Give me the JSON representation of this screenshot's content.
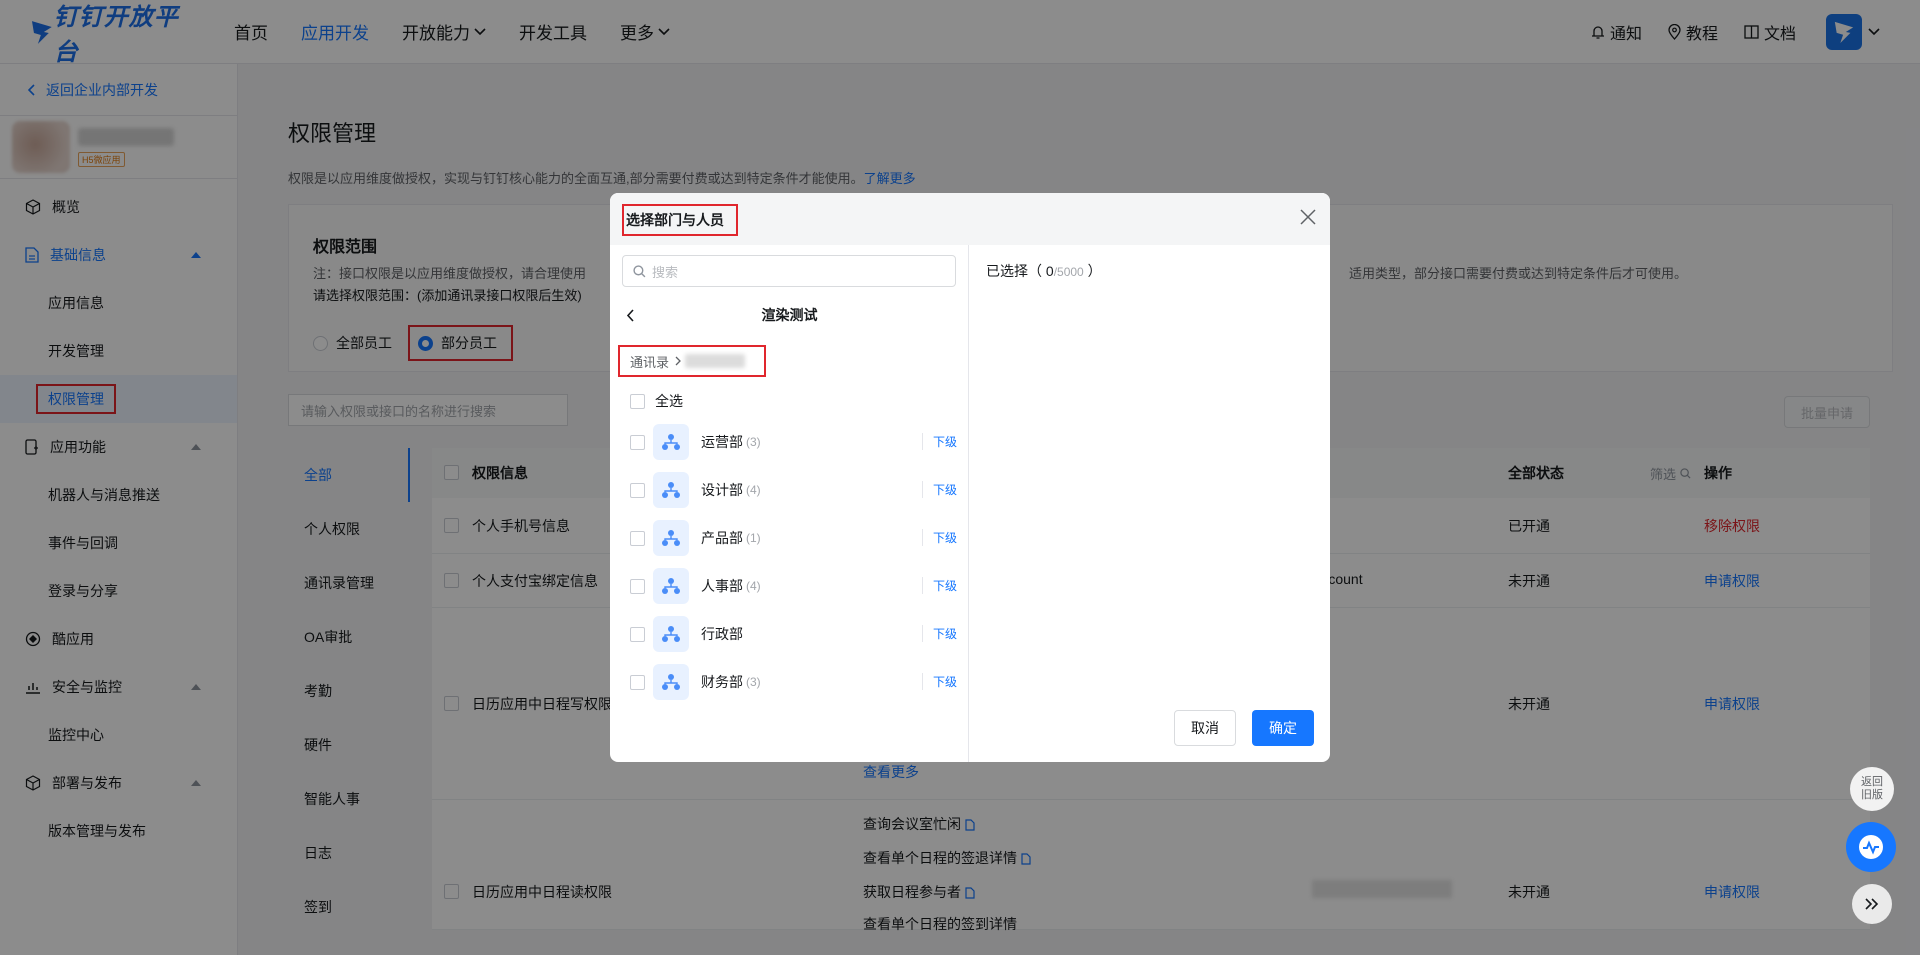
{
  "header": {
    "logo": "钉钉开放平台",
    "nav": [
      "首页",
      "应用开发",
      "开放能力",
      "开发工具",
      "更多"
    ],
    "right": [
      "通知",
      "教程",
      "文档"
    ]
  },
  "sidebar": {
    "back": "返回企业内部开发",
    "app_tag": "H5微应用",
    "items": [
      {
        "label": "概览"
      },
      {
        "label": "基础信息"
      },
      {
        "label": "应用信息"
      },
      {
        "label": "开发管理"
      },
      {
        "label": "权限管理"
      },
      {
        "label": "应用功能"
      },
      {
        "label": "机器人与消息推送"
      },
      {
        "label": "事件与回调"
      },
      {
        "label": "登录与分享"
      },
      {
        "label": "酷应用"
      },
      {
        "label": "安全与监控"
      },
      {
        "label": "监控中心"
      },
      {
        "label": "部署与发布"
      },
      {
        "label": "版本管理与发布"
      }
    ]
  },
  "main": {
    "title": "权限管理",
    "desc": "权限是以应用维度做授权，实现与钉钉核心能力的全面互通,部分需要付费或达到特定条件才能使用。",
    "desc_link": "了解更多",
    "scope": {
      "title": "权限范围",
      "note": "注：接口权限是以应用维度做授权，请合理使用",
      "note_right": "适用类型，部分接口需要付费或达到特定条件后才可使用。",
      "prompt": "请选择权限范围：(添加通讯录接口权限后生效)",
      "opt_all": "全部员工",
      "opt_part": "部分员工"
    },
    "search_placeholder": "请输入权限或接口的名称进行搜索",
    "batch": "批量申请",
    "categories": [
      "全部",
      "个人权限",
      "通讯录管理",
      "OA审批",
      "考勤",
      "硬件",
      "智能人事",
      "日志",
      "签到"
    ],
    "table": {
      "col_info": "权限信息",
      "col_status": "全部状态",
      "col_filter": "筛选",
      "col_op": "操作",
      "rows": [
        {
          "name": "个人手机号信息",
          "extra": "",
          "status": "已开通",
          "op": "移除权限"
        },
        {
          "name": "个人支付宝绑定信息",
          "extra": "Account",
          "status": "未开通",
          "op": "申请权限"
        },
        {
          "name": "日历应用中日程写权限",
          "extra": "e",
          "status": "未开通",
          "op": "申请权限"
        },
        {
          "name": "日历应用中日程读权限",
          "extra": "",
          "status": "未开通",
          "op": "申请权限"
        }
      ],
      "more": "查看更多",
      "apis": [
        "查询会议室忙闲",
        "查看单个日程的签退详情",
        "获取日程参与者",
        "查看单个日程的签到详情"
      ]
    }
  },
  "modal": {
    "title": "选择部门与人员",
    "search_placeholder": "搜索",
    "org": "渲染测试",
    "crumb_root": "通讯录",
    "select_all": "全选",
    "depts": [
      {
        "name": "运营部",
        "count": "(3)",
        "sub": "下级"
      },
      {
        "name": "设计部",
        "count": "(4)",
        "sub": "下级"
      },
      {
        "name": "产品部",
        "count": "(1)",
        "sub": "下级"
      },
      {
        "name": "人事部",
        "count": "(4)",
        "sub": "下级"
      },
      {
        "name": "行政部",
        "count": "",
        "sub": "下级"
      },
      {
        "name": "财务部",
        "count": "(3)",
        "sub": "下级"
      }
    ],
    "selected_label": "已选择",
    "selected_count": "0",
    "selected_max": "/5000",
    "cancel": "取消",
    "confirm": "确定"
  },
  "floats": {
    "old_version": "返回旧版"
  }
}
